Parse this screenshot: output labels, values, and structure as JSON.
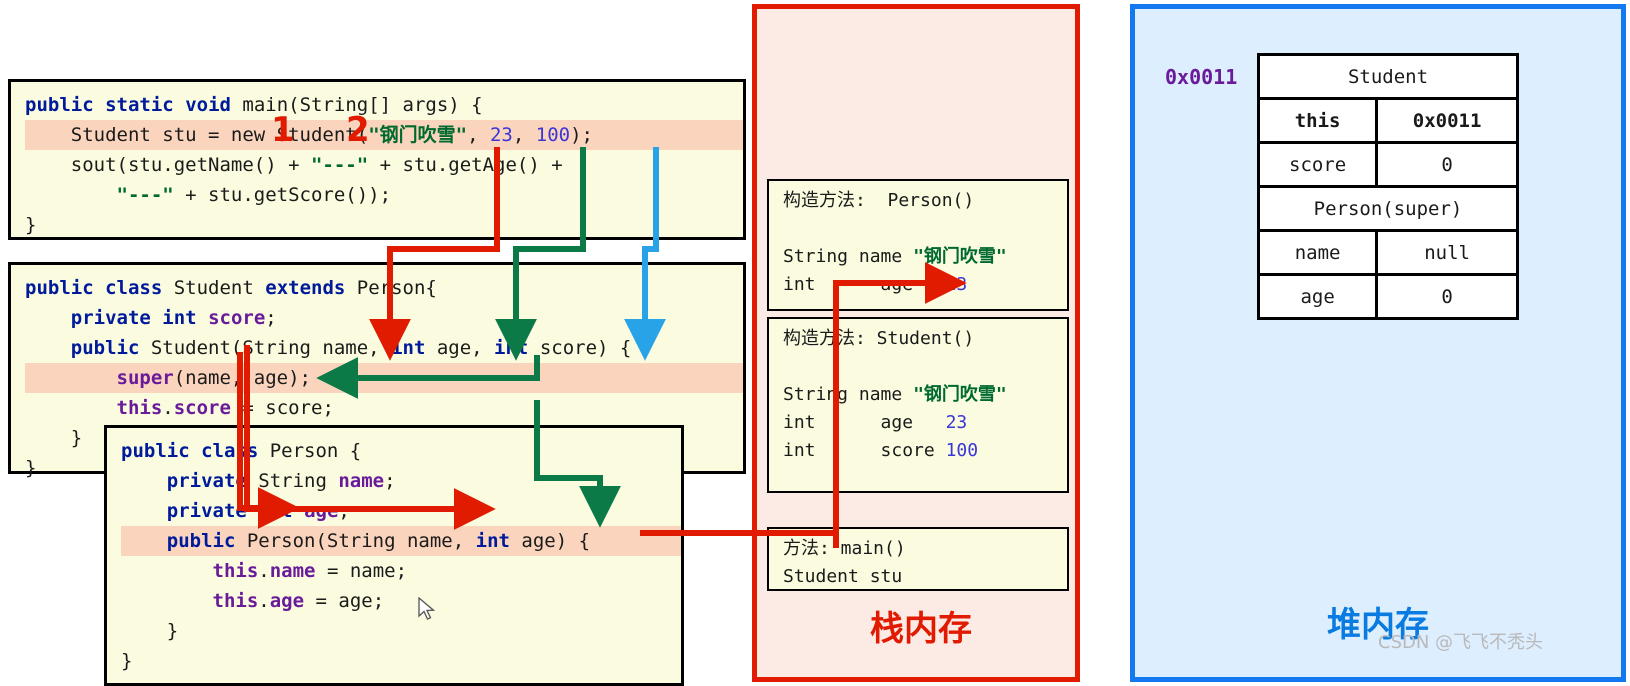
{
  "code_blocks": {
    "main": {
      "lines": [
        "public static void main(String[] args) {",
        "    Student stu = new Student(\"钢门吹雪\", 23, 100);",
        "    sout(stu.getName() + \"---\" + stu.getAge() +",
        "        \"---\" + stu.getScore());",
        "}"
      ]
    },
    "student": {
      "lines": [
        "public class Student extends Person{",
        "    private int score;",
        "    public Student(String name, int age, int score) {",
        "        super(name, age);",
        "        this.score = score;",
        "    }",
        "}"
      ]
    },
    "person": {
      "lines": [
        "public class Person {",
        "    private String name;",
        "    private int age;",
        "    public Person(String name, int age) {",
        "        this.name = name;",
        "        this.age = age;",
        "    }",
        "}"
      ]
    }
  },
  "step_markers": {
    "one": "1",
    "two": "2"
  },
  "stack": {
    "title": "栈内存",
    "frames": [
      {
        "header": "构造方法:  Person()",
        "rows": [
          {
            "type": "String",
            "name": "name",
            "value": "\"钢门吹雪\""
          },
          {
            "type": "int",
            "name": "age",
            "value": "23"
          }
        ]
      },
      {
        "header": "构造方法: Student()",
        "rows": [
          {
            "type": "String",
            "name": "name",
            "value": "\"钢门吹雪\""
          },
          {
            "type": "int",
            "name": "age",
            "value": "23"
          },
          {
            "type": "int",
            "name": "score",
            "value": "100"
          }
        ]
      },
      {
        "header": "方法: main()",
        "rows": [
          {
            "type": "Student",
            "name": "stu",
            "value": ""
          }
        ]
      }
    ]
  },
  "heap": {
    "title": "堆内存",
    "address": "0x0011",
    "object_table": {
      "class_name": "Student",
      "super_label": "Person(super)",
      "rows": [
        {
          "key": "this",
          "value": "0x0011"
        },
        {
          "key": "score",
          "value": "0"
        },
        {
          "key": "name",
          "value": "null"
        },
        {
          "key": "age",
          "value": "0"
        }
      ]
    }
  },
  "watermark": "CSDN @飞飞不秃头",
  "colors": {
    "stack_border": "#e01b00",
    "heap_border": "#1478f0",
    "heap_bg": "#ddeeff",
    "stack_bg": "#fceae4",
    "code_bg": "#fbfbe0",
    "highlight": "#fbd4bd",
    "arrow_red": "#e01b00",
    "arrow_green": "#0b7a47",
    "arrow_blue": "#29a3e8",
    "keyword": "#001a9c",
    "string": "#006a2e",
    "number": "#3a37d6",
    "field": "#6a1b9a"
  }
}
